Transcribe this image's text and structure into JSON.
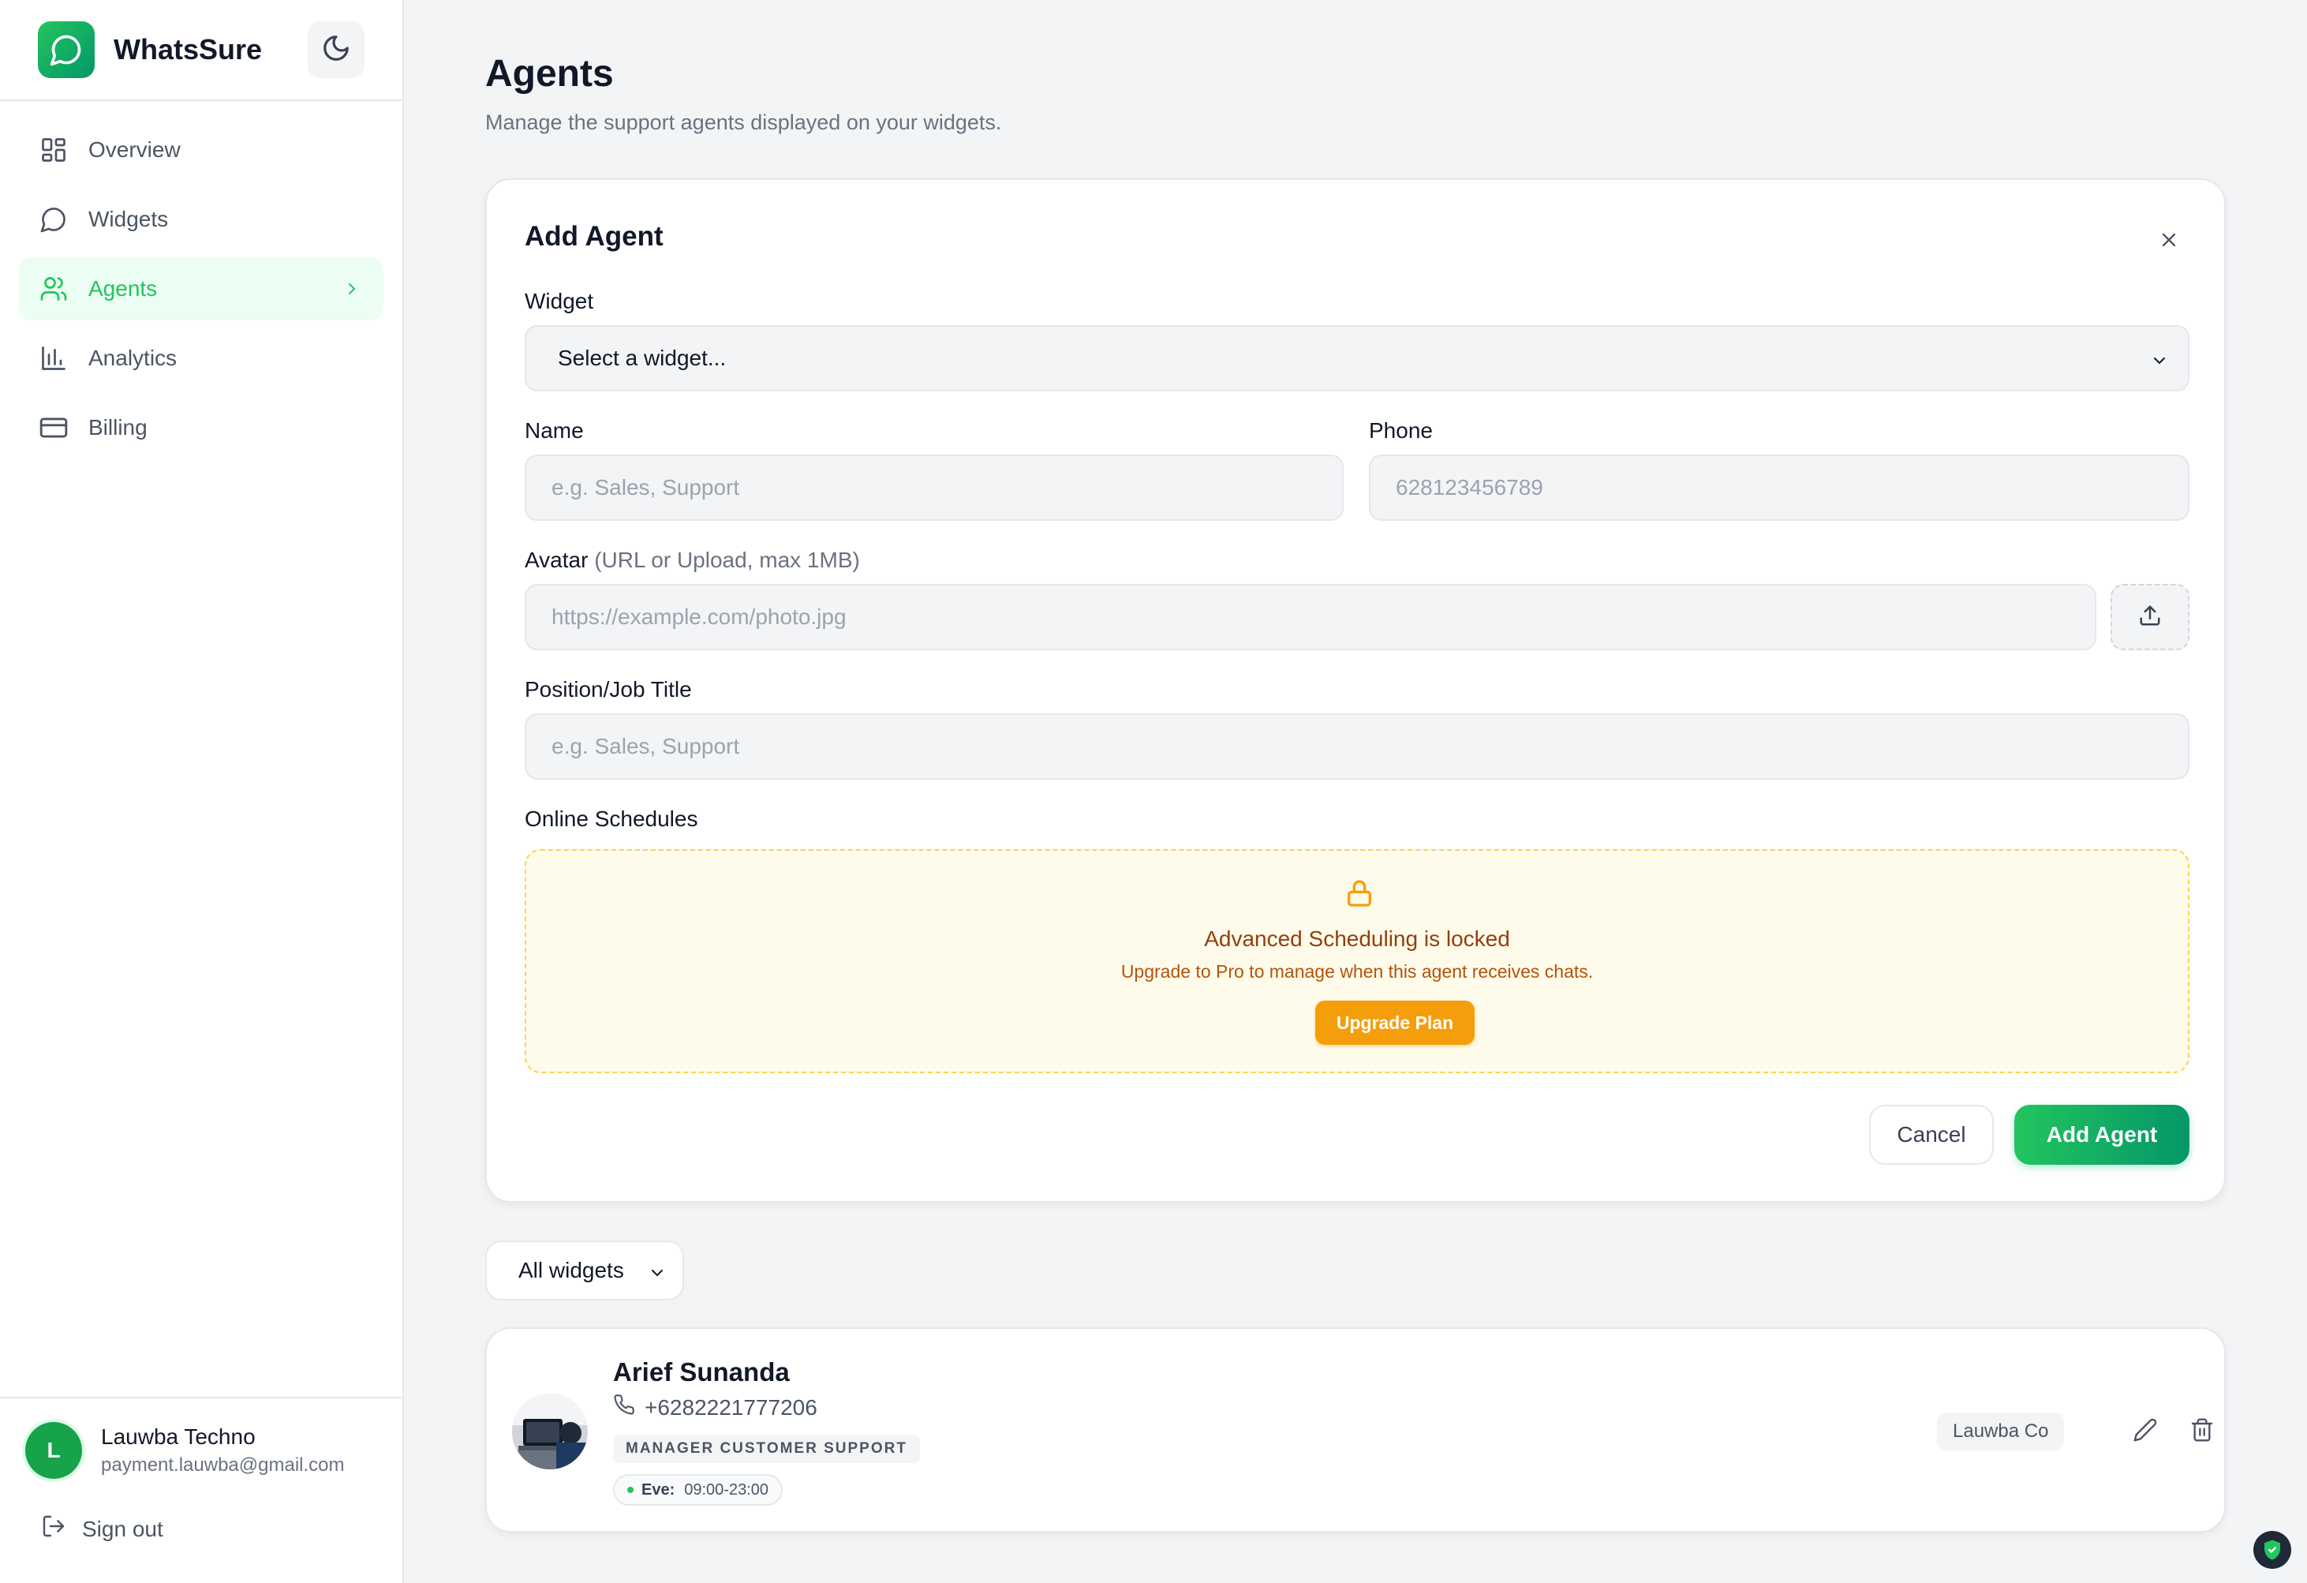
{
  "app": {
    "name": "WhatsSure",
    "accent": "#22c55e"
  },
  "sidebar": {
    "items": [
      {
        "label": "Overview",
        "icon": "grid-icon"
      },
      {
        "label": "Widgets",
        "icon": "chat-bubble-icon"
      },
      {
        "label": "Agents",
        "icon": "users-icon",
        "active": true
      },
      {
        "label": "Analytics",
        "icon": "bar-chart-icon"
      },
      {
        "label": "Billing",
        "icon": "credit-card-icon"
      }
    ],
    "user": {
      "initial": "L",
      "name": "Lauwba Techno",
      "email": "payment.lauwba@gmail.com"
    },
    "signout_label": "Sign out"
  },
  "page": {
    "title": "Agents",
    "subtitle": "Manage the support agents displayed on your widgets."
  },
  "add_agent_form": {
    "title": "Add Agent",
    "widget": {
      "label": "Widget",
      "value": "Select a widget..."
    },
    "name": {
      "label": "Name",
      "placeholder": "e.g. Sales, Support"
    },
    "phone": {
      "label": "Phone",
      "placeholder": "628123456789"
    },
    "avatar": {
      "label": "Avatar",
      "hint": "(URL or Upload, max 1MB)",
      "placeholder": "https://example.com/photo.jpg"
    },
    "position": {
      "label": "Position/Job Title",
      "placeholder": "e.g. Sales, Support"
    },
    "schedules": {
      "label": "Online Schedules",
      "locked_title": "Advanced Scheduling is locked",
      "locked_desc": "Upgrade to Pro to manage when this agent receives chats.",
      "upgrade_label": "Upgrade Plan"
    },
    "cancel_label": "Cancel",
    "submit_label": "Add Agent"
  },
  "filter": {
    "value": "All widgets"
  },
  "agents": [
    {
      "name": "Arief Sunanda",
      "phone": "+6282221777206",
      "role": "MANAGER CUSTOMER SUPPORT",
      "schedule_day": "Eve:",
      "schedule_time": "09:00-23:00",
      "widget": "Lauwba Co"
    }
  ]
}
